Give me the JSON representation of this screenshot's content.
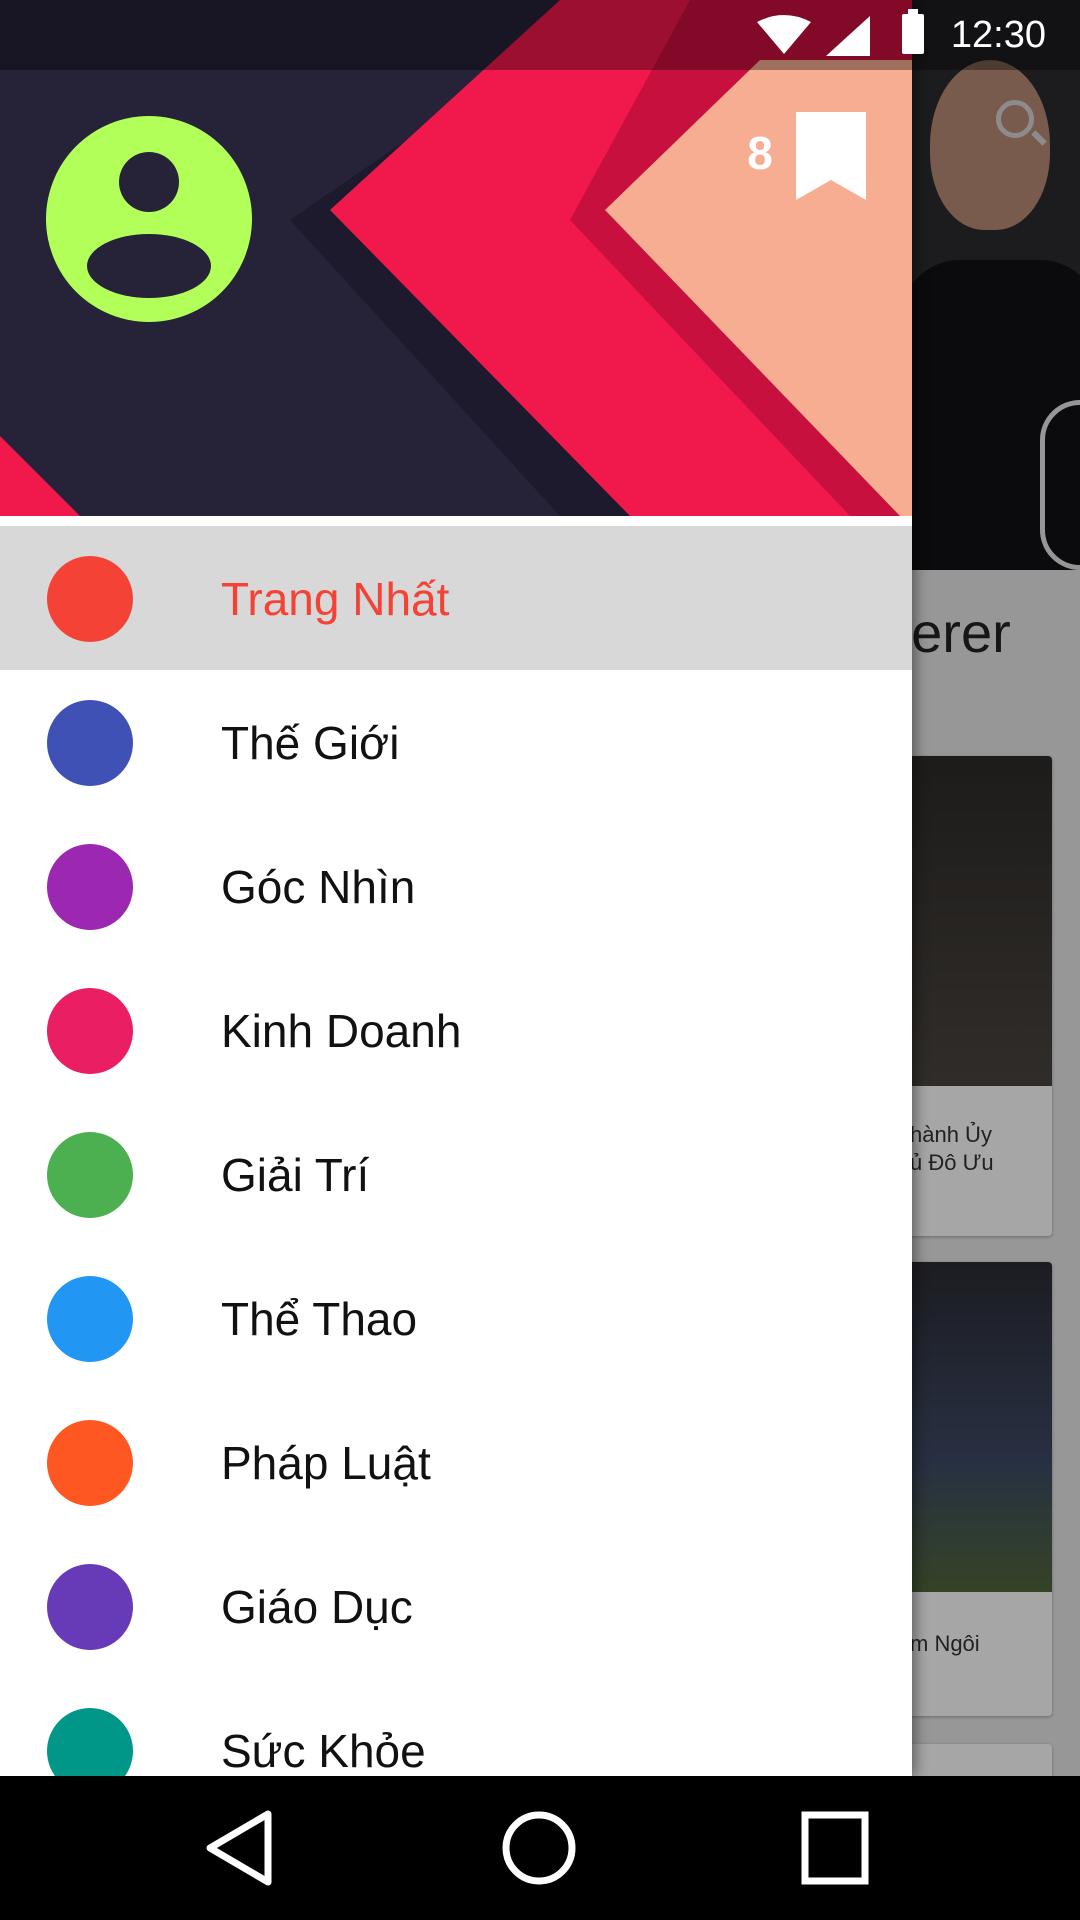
{
  "status_bar": {
    "time": "12:30",
    "icons": [
      "wifi-icon",
      "signal-icon",
      "battery-icon"
    ]
  },
  "background_app": {
    "headline_fragment": "derer",
    "card_1_lines": [
      "hành Ủy",
      "ủ Đô Ưu"
    ],
    "card_2_lines": [
      "m Ngôi"
    ],
    "icons": [
      "search-icon"
    ]
  },
  "drawer": {
    "header": {
      "avatar_icon": "account-circle-icon",
      "bookmark_count": "8",
      "bookmark_icon": "bookmark-icon"
    },
    "items": [
      {
        "label": "Trang Nhất",
        "color": "#f44336",
        "selected": true
      },
      {
        "label": "Thế Giới",
        "color": "#3f51b5",
        "selected": false
      },
      {
        "label": "Góc Nhìn",
        "color": "#9c27b0",
        "selected": false
      },
      {
        "label": "Kinh Doanh",
        "color": "#e91e63",
        "selected": false
      },
      {
        "label": "Giải Trí",
        "color": "#4caf50",
        "selected": false
      },
      {
        "label": "Thể Thao",
        "color": "#2196f3",
        "selected": false
      },
      {
        "label": "Pháp Luật",
        "color": "#ff5722",
        "selected": false
      },
      {
        "label": "Giáo Dục",
        "color": "#673ab7",
        "selected": false
      },
      {
        "label": "Sức Khỏe",
        "color": "#009688",
        "selected": false
      }
    ]
  },
  "nav_bar": {
    "buttons": [
      "back-icon",
      "home-icon",
      "recents-icon"
    ]
  },
  "colors": {
    "accent": "#f44336",
    "avatar": "#b2ff59",
    "header_dark": "#262238",
    "header_pink": "#f1184c"
  }
}
